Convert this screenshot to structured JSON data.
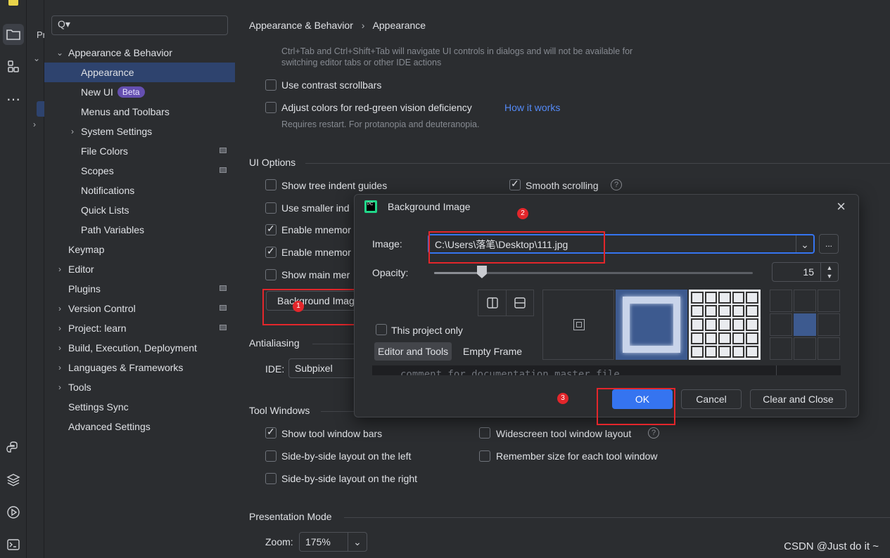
{
  "left_strip": {
    "icons": [
      "folder-icon",
      "structure-icon",
      "more-icon",
      "python-console-icon",
      "layers-icon",
      "run-icon",
      "terminal-icon"
    ],
    "project_panel_label": "Pr"
  },
  "search": {
    "placeholder": "Q▾"
  },
  "tree": {
    "items": [
      {
        "label": "Appearance & Behavior",
        "expanded": true
      },
      {
        "label": "Appearance"
      },
      {
        "label": "New UI",
        "badge": "Beta"
      },
      {
        "label": "Menus and Toolbars"
      },
      {
        "label": "System Settings"
      },
      {
        "label": "File Colors"
      },
      {
        "label": "Scopes"
      },
      {
        "label": "Notifications"
      },
      {
        "label": "Quick Lists"
      },
      {
        "label": "Path Variables"
      },
      {
        "label": "Keymap"
      },
      {
        "label": "Editor"
      },
      {
        "label": "Plugins"
      },
      {
        "label": "Version Control"
      },
      {
        "label": "Project: learn"
      },
      {
        "label": "Build, Execution, Deployment"
      },
      {
        "label": "Languages & Frameworks"
      },
      {
        "label": "Tools"
      },
      {
        "label": "Settings Sync"
      },
      {
        "label": "Advanced Settings"
      }
    ]
  },
  "breadcrumb": {
    "parent": "Appearance & Behavior",
    "separator": "›",
    "current": "Appearance"
  },
  "main": {
    "note_line1": "Ctrl+Tab and Ctrl+Shift+Tab will navigate UI controls in dialogs and will not be available for",
    "note_line2": "switching editor tabs or other IDE actions",
    "contrast_scrollbars": "Use contrast scrollbars",
    "adjust_colors": "Adjust colors for red-green vision deficiency",
    "how_it_works": "How it works",
    "requires_restart": "Requires restart. For protanopia and deuteranopia.",
    "ui_options": "UI Options",
    "tree_indent": "Show tree indent guides",
    "smooth_scrolling": "Smooth scrolling",
    "smaller_indents": "Use smaller ind",
    "enable_mnemonics1": "Enable mnemor",
    "enable_mnemonics2": "Enable mnemor",
    "show_main_menu": "Show main mer",
    "background_image_button": "Background Imag",
    "antialiasing": "Antialiasing",
    "ide_label": "IDE:",
    "ide_value": "Subpixel",
    "tool_windows": "Tool Windows",
    "show_tool_window_bars": "Show tool window bars",
    "widescreen_layout": "Widescreen tool window layout",
    "side_by_side_left": "Side-by-side layout on the left",
    "remember_size": "Remember size for each tool window",
    "side_by_side_right": "Side-by-side layout on the right",
    "presentation_mode": "Presentation Mode",
    "zoom_label": "Zoom:",
    "zoom_value": "175%"
  },
  "dialog": {
    "title": "Background Image",
    "image_label": "Image:",
    "image_value": "C:\\Users\\落笔\\Desktop\\111.jpg",
    "browse": "...",
    "opacity_label": "Opacity:",
    "opacity_value": "15",
    "opacity_fraction": 0.15,
    "this_project_only": "This project only",
    "tab_editor_tools": "Editor and Tools",
    "tab_empty_frame": "Empty Frame",
    "code_preview": "comment for documentation master file",
    "ok": "OK",
    "cancel": "Cancel",
    "clear_close": "Clear and Close"
  },
  "annotations": {
    "marker1": "1",
    "marker2": "2",
    "marker3": "3"
  },
  "watermark": "CSDN @Just do it ~",
  "colors": {
    "accent": "#2e436e",
    "ok_button": "#3574f0",
    "highlight_red": "#e3262b",
    "link": "#548af7"
  }
}
